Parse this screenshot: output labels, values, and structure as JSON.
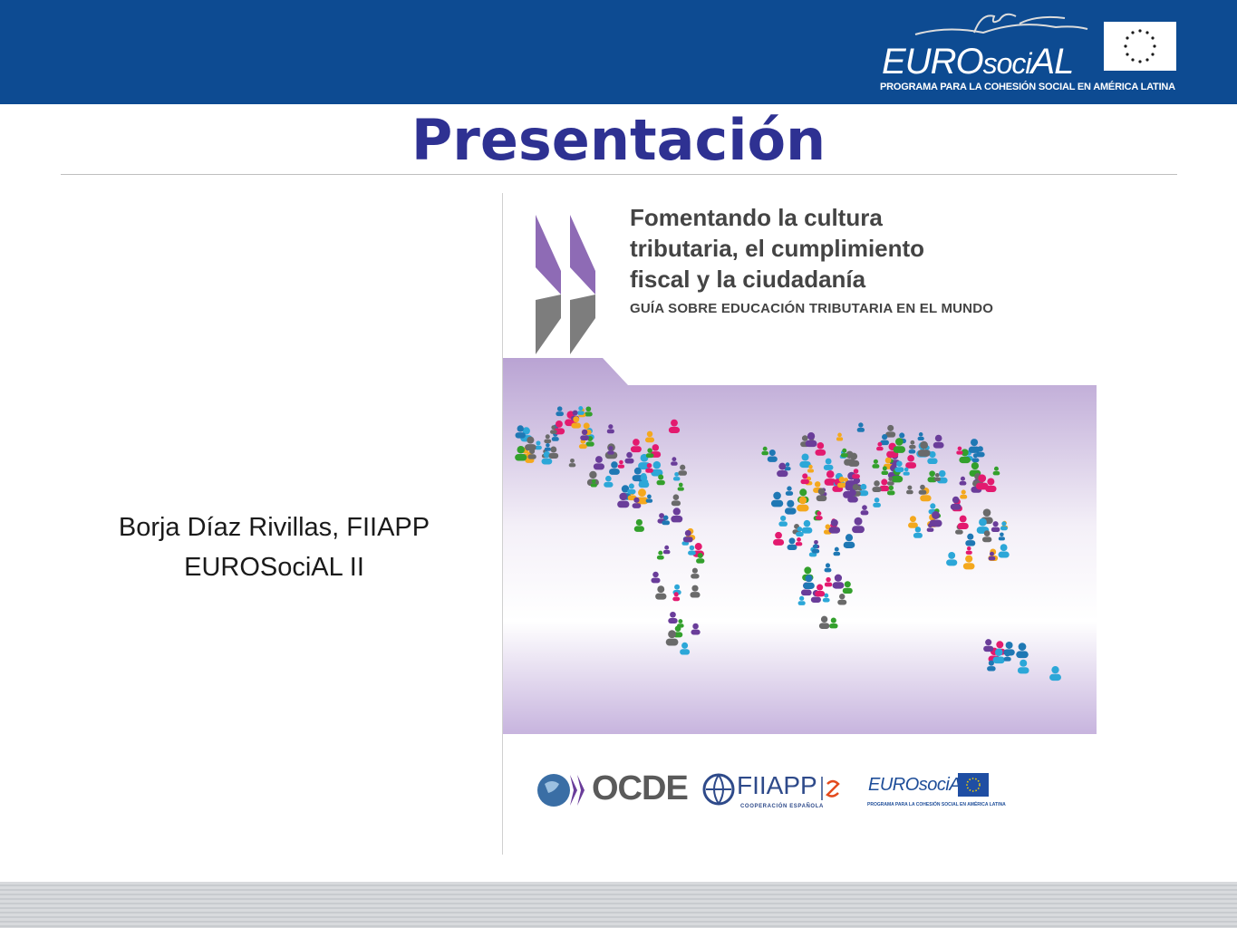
{
  "header": {
    "logo_word_a": "EURO",
    "logo_word_b": "soci",
    "logo_word_c": "AL",
    "logo_tagline": "PROGRAMA PARA LA COHESIÓN SOCIAL EN AMÉRICA LATINA",
    "bar_color": "#0d4b92"
  },
  "slide": {
    "title": "Presentación",
    "title_color": "#2e3192",
    "author_line1": "Borja Díaz Rivillas, FIIAPP",
    "author_line2": "EUROSociAL II"
  },
  "cover": {
    "title_line1": "Fomentando la cultura",
    "title_line2": "tributaria, el cumplimiento",
    "title_line3": "fiscal y la ciudadanía",
    "subtitle": "GUÍA SOBRE EDUCACIÓN TRIBUTARIA EN EL MUNDO",
    "logo_ocde": "OCDE",
    "logo_fiiapp": "FIIAPP",
    "logo_fiiapp_sub": "COOPERACIÓN ESPAÑOLA",
    "logo_euro_a": "EURO",
    "logo_euro_b": "sociAL",
    "logo_euro_sub": "PROGRAMA PARA LA COHESIÓN SOCIAL EN AMÉRICA LATINA",
    "accent_purple": "#8e6bb5",
    "people_colors": [
      "#6a3d9a",
      "#2ca7d8",
      "#33a02c",
      "#f4a81d",
      "#e31a6f",
      "#1f78b4",
      "#6a6a6a"
    ]
  }
}
